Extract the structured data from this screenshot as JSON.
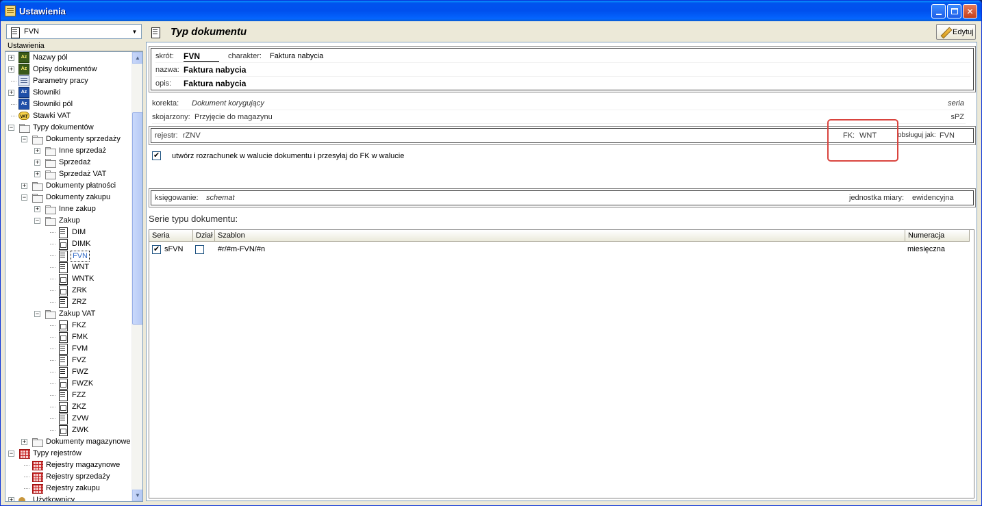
{
  "window": {
    "title": "Ustawienia"
  },
  "left": {
    "combo_value": "FVN",
    "panel_title": "Ustawienia",
    "tree": [
      {
        "label": "Nazwy pól",
        "level": 0,
        "icon": "az-green-icon",
        "expander": "+"
      },
      {
        "label": "Opisy dokumentów",
        "level": 0,
        "icon": "az-green-icon",
        "expander": "+"
      },
      {
        "label": "Parametry pracy",
        "level": 0,
        "icon": "params-icon",
        "expander": ""
      },
      {
        "label": "Słowniki",
        "level": 0,
        "icon": "az-blue-icon",
        "expander": "+"
      },
      {
        "label": "Słowniki pól",
        "level": 0,
        "icon": "az-blue-icon",
        "expander": ""
      },
      {
        "label": "Stawki VAT",
        "level": 0,
        "icon": "vat-icon",
        "expander": ""
      },
      {
        "label": "Typy dokumentów",
        "level": 0,
        "icon": "folder-icon",
        "expander": "-"
      },
      {
        "label": "Dokumenty sprzedaży",
        "level": 1,
        "icon": "folder-icon",
        "expander": "-"
      },
      {
        "label": "Inne sprzedaż",
        "level": 2,
        "icon": "folder-icon",
        "expander": "+"
      },
      {
        "label": "Sprzedaż",
        "level": 2,
        "icon": "folder-icon",
        "expander": "+"
      },
      {
        "label": "Sprzedaż VAT",
        "level": 2,
        "icon": "folder-icon",
        "expander": "+"
      },
      {
        "label": "Dokumenty płatności",
        "level": 1,
        "icon": "folder-icon",
        "expander": "+"
      },
      {
        "label": "Dokumenty zakupu",
        "level": 1,
        "icon": "folder-icon",
        "expander": "-"
      },
      {
        "label": "Inne zakup",
        "level": 2,
        "icon": "folder-icon",
        "expander": "+"
      },
      {
        "label": "Zakup",
        "level": 2,
        "icon": "folder-icon",
        "expander": "-"
      },
      {
        "label": "DIM",
        "level": 3,
        "icon": "document-icon",
        "expander": ""
      },
      {
        "label": "DIMK",
        "level": 3,
        "icon": "document-image-icon",
        "expander": ""
      },
      {
        "label": "FVN",
        "level": 3,
        "icon": "document-icon",
        "expander": "",
        "selected": true
      },
      {
        "label": "WNT",
        "level": 3,
        "icon": "document-icon",
        "expander": ""
      },
      {
        "label": "WNTK",
        "level": 3,
        "icon": "document-image-icon",
        "expander": ""
      },
      {
        "label": "ZRK",
        "level": 3,
        "icon": "document-image-icon",
        "expander": ""
      },
      {
        "label": "ZRZ",
        "level": 3,
        "icon": "document-icon",
        "expander": ""
      },
      {
        "label": "Zakup VAT",
        "level": 2,
        "icon": "folder-icon",
        "expander": "-"
      },
      {
        "label": "FKZ",
        "level": 3,
        "icon": "document-image-icon",
        "expander": ""
      },
      {
        "label": "FMK",
        "level": 3,
        "icon": "document-image-icon",
        "expander": ""
      },
      {
        "label": "FVM",
        "level": 3,
        "icon": "document-icon",
        "expander": ""
      },
      {
        "label": "FVZ",
        "level": 3,
        "icon": "document-icon",
        "expander": ""
      },
      {
        "label": "FWZ",
        "level": 3,
        "icon": "document-icon",
        "expander": ""
      },
      {
        "label": "FWZK",
        "level": 3,
        "icon": "document-image-icon",
        "expander": ""
      },
      {
        "label": "FZZ",
        "level": 3,
        "icon": "document-icon",
        "expander": ""
      },
      {
        "label": "ZKZ",
        "level": 3,
        "icon": "document-image-icon",
        "expander": ""
      },
      {
        "label": "ZVW",
        "level": 3,
        "icon": "document-icon",
        "expander": ""
      },
      {
        "label": "ZWK",
        "level": 3,
        "icon": "document-image-icon",
        "expander": ""
      },
      {
        "label": "Dokumenty magazynowe",
        "level": 1,
        "icon": "folder-icon",
        "expander": "+"
      },
      {
        "label": "Typy rejestrów",
        "level": 0,
        "icon": "register-icon",
        "expander": "-"
      },
      {
        "label": "Rejestry magazynowe",
        "level": 1,
        "icon": "register-icon",
        "expander": ""
      },
      {
        "label": "Rejestry sprzedaży",
        "level": 1,
        "icon": "register-icon",
        "expander": ""
      },
      {
        "label": "Rejestry zakupu",
        "level": 1,
        "icon": "register-icon",
        "expander": ""
      },
      {
        "label": "Użytkownicy",
        "level": 0,
        "icon": "users-icon",
        "expander": "+"
      }
    ]
  },
  "right": {
    "title": "Typ dokumentu",
    "edit_label": "Edytuj",
    "header_box": {
      "skrot_label": "skrót:",
      "skrot_value": "FVN",
      "charakter_label": "charakter:",
      "charakter_value": "Faktura nabycia",
      "nazwa_label": "nazwa:",
      "nazwa_value": "Faktura nabycia",
      "opis_label": "opis:",
      "opis_value": "Faktura nabycia"
    },
    "korekta_label": "korekta:",
    "korekta_value": "Dokument korygujący",
    "korekta_seria": "seria",
    "skojarzony_label": "skojarzony:",
    "skojarzony_value": "Przyjęcie do magazynu",
    "skojarzony_seria": "sPZ",
    "registry": {
      "rejestr_label": "rejestr:",
      "rejestr_value": "rZNV",
      "fk_label": "FK:",
      "fk_value": "WNT",
      "obsluguj_label": "obsługuj jak:",
      "obsluguj_value": "FVN"
    },
    "checkbox_label": "utwórz rozrachunek w walucie dokumentu i przesyłaj do FK w walucie",
    "posting": {
      "ksiegowanie_label": "księgowanie:",
      "ksiegowanie_value": "schemat",
      "jm_label": "jednostka miary:",
      "jm_value": "ewidencyjna"
    },
    "series_title": "Serie typu dokumentu:",
    "series_columns": [
      "Seria",
      "Dział",
      "Szablon",
      "Numeracja"
    ],
    "series_rows": [
      {
        "seria": "sFVN",
        "seria_checked": true,
        "dzial_checked": false,
        "szablon": "#r/#m-FVN/#n",
        "numeracja": "miesięczna"
      }
    ]
  }
}
